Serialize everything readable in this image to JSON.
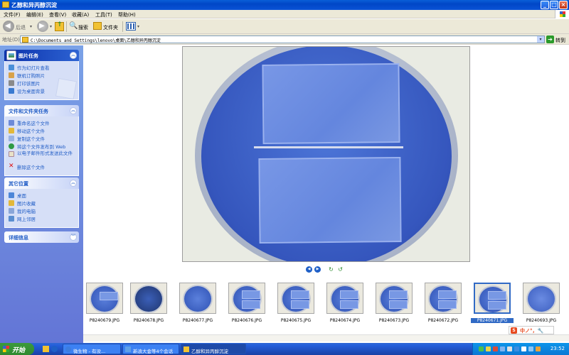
{
  "window": {
    "title": "乙醇和异丙醇沉淀"
  },
  "menu": [
    "文件(F)",
    "编辑(E)",
    "查看(V)",
    "收藏(A)",
    "工具(T)",
    "帮助(H)"
  ],
  "toolbar": {
    "back_label": "后退",
    "search_label": "搜索",
    "folders_label": "文件夹"
  },
  "address": {
    "label": "地址(D)",
    "path": "C:\\Documents and Settings\\lenovo\\桌面\\乙醇和异丙醇沉淀",
    "go_label": "转到"
  },
  "panels": {
    "picture_tasks": {
      "title": "图片任务",
      "items": [
        "作为幻灯片查看",
        "联机订购照片",
        "打印该图片",
        "设为桌面背景"
      ]
    },
    "file_tasks": {
      "title": "文件和文件夹任务",
      "items": [
        "重命名这个文件",
        "移动这个文件",
        "复制这个文件",
        "将这个文件发布到 Web",
        "以电子邮件形式发送此文件",
        "删除这个文件"
      ]
    },
    "other_places": {
      "title": "其它位置",
      "items": [
        "桌面",
        "图片收藏",
        "我的电脑",
        "网上邻居"
      ]
    },
    "details": {
      "title": "详细信息"
    }
  },
  "filmstrip": {
    "selected_index": 8,
    "thumbs": [
      "P8240679.JPG",
      "P8240678.JPG",
      "P8240677.JPG",
      "P8240676.JPG",
      "P8240675.JPG",
      "P8240674.JPG",
      "P8240673.JPG",
      "P8240672.JPG",
      "P8240671.JPG",
      "P8240693.JPG"
    ]
  },
  "ime": {
    "text": "中ノ°，🔧"
  },
  "taskbar": {
    "start_label": "开始",
    "tasks": [
      "微生物 - 有没...",
      "新浪大金等4个会话",
      "乙醇和异丙醇沉淀"
    ],
    "active_task_index": 2,
    "clock": "23:52"
  },
  "colors": {
    "title_bar": "#0a53d6",
    "panel_bg": "#d6dff7",
    "link_text": "#215dc6",
    "selection": "#316ac5",
    "start_green": "#2f8a2f"
  }
}
